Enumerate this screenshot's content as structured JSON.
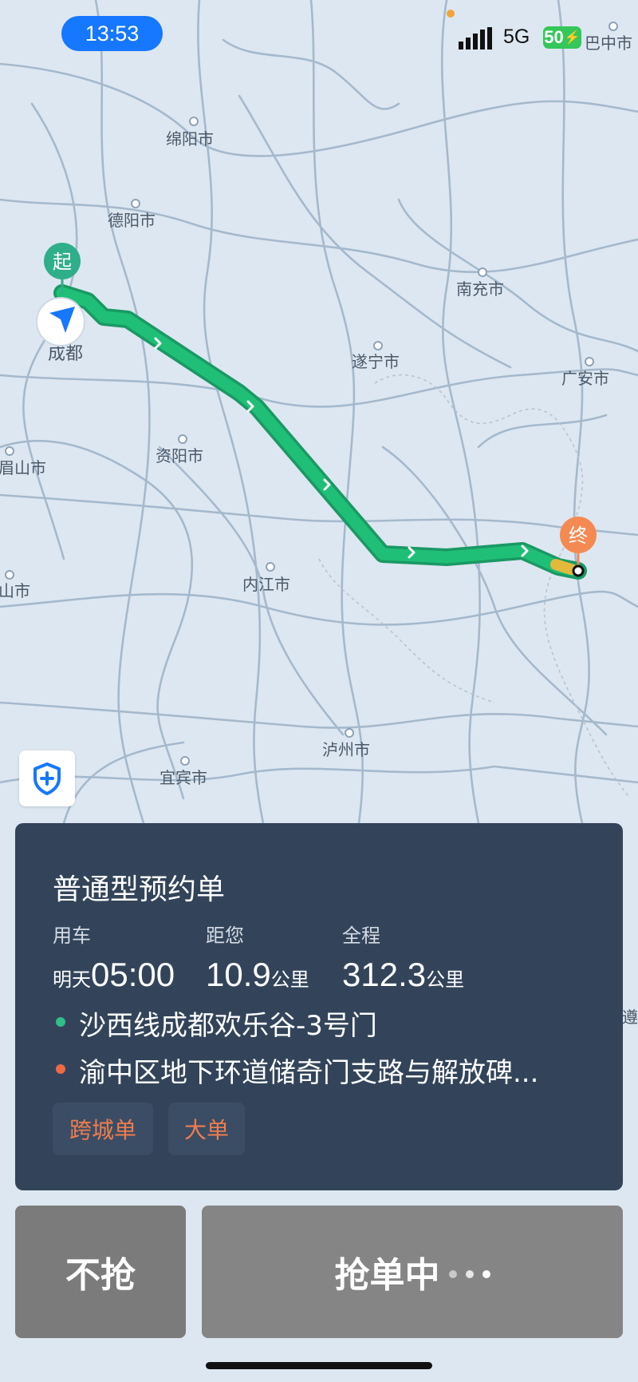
{
  "status_bar": {
    "time": "13:53",
    "network": "5G",
    "battery": "50"
  },
  "map": {
    "labels": {
      "mianyang": "绵阳市",
      "deyang": "德阳市",
      "chengdu": "成都",
      "nanchong": "南充市",
      "suining": "遂宁市",
      "guangan": "广安市",
      "ziyang": "资阳市",
      "meishan": "眉山市",
      "leshan": "山市",
      "neijiang": "内江市",
      "luzhou": "泸州市",
      "yibin": "宜宾市",
      "bazhong": "巴中市",
      "zun": "遵"
    },
    "start_marker": "起",
    "end_marker": "终",
    "colors": {
      "route": "#1aab6e",
      "start": "#2fae8a",
      "end": "#f48a52"
    }
  },
  "order": {
    "title": "普通型预约单",
    "use_time": {
      "label": "用车",
      "prefix": "明天",
      "value": "05:00"
    },
    "distance_to_you": {
      "label": "距您",
      "value": "10.9",
      "unit": "公里"
    },
    "total": {
      "label": "全程",
      "value": "312.3",
      "unit": "公里"
    },
    "pickup": "沙西线成都欢乐谷-3号门",
    "dropoff": "渝中区地下环道储奇门支路与解放碑...",
    "tags": [
      "跨城单",
      "大单"
    ],
    "colors": {
      "card": "#33445a",
      "tag_text": "#ee7d4f"
    }
  },
  "actions": {
    "decline": "不抢",
    "grab": "抢单中"
  }
}
